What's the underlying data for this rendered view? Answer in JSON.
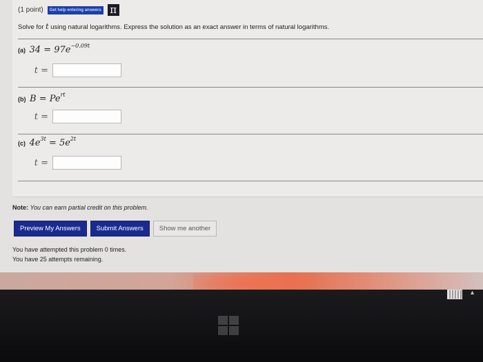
{
  "problem": {
    "points": "(1 point)",
    "help_link": "Get help entering answers",
    "pi_symbol": "π",
    "instructions_pre": "Solve for",
    "variable": "t",
    "instructions_post": "using natural logarithms. Express the solution as an exact answer in terms of natural logarithms.",
    "parts": [
      {
        "label": "(a)",
        "lhs": "34 = 97e",
        "exponent": "−0.09t",
        "answer_var": "t =",
        "answer_value": ""
      },
      {
        "label": "(b)",
        "lhs": "B = Pe",
        "exponent": "rt",
        "answer_var": "t =",
        "answer_value": ""
      },
      {
        "label": "(c)",
        "lhs": "4e",
        "exponent": "3t",
        "rhs": " = 5e",
        "rhs_exponent": "2t",
        "answer_var": "t =",
        "answer_value": ""
      }
    ]
  },
  "note": {
    "label": "Note:",
    "text": "You can earn partial credit on this problem."
  },
  "buttons": {
    "preview": "Preview My Answers",
    "submit": "Submit Answers",
    "another": "Show me another"
  },
  "attempts": {
    "line1": "You have attempted this problem 0 times.",
    "line2": "You have 25 attempts remaining."
  },
  "colors": {
    "primary_button": "#1a2b8f",
    "help_link_bg": "#1d3fa8"
  }
}
